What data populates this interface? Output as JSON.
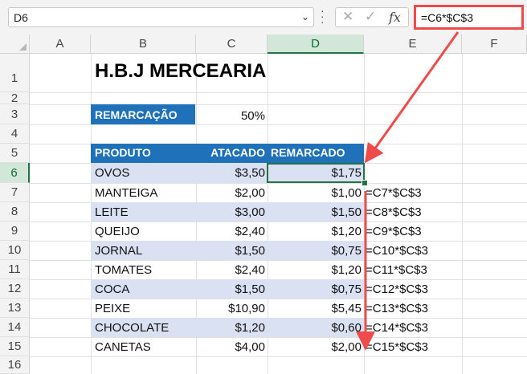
{
  "formula_bar": {
    "name_box": "D6",
    "formula": "=C6*$C$3",
    "cancel_glyph": "✕",
    "enter_glyph": "✓",
    "fx_glyph": "fx"
  },
  "columns": [
    "A",
    "B",
    "C",
    "D",
    "E",
    "F"
  ],
  "rows": [
    "1",
    "2",
    "3",
    "4",
    "5",
    "6",
    "7",
    "8",
    "9",
    "10",
    "11",
    "12",
    "13",
    "14",
    "15",
    "16"
  ],
  "sheet": {
    "title": "H.B.J MERCEARIA",
    "remarcacao_label": "REMARCAÇÃO",
    "remarcacao_value": "50%",
    "headers": {
      "produto": "PRODUTO",
      "atacado": "ATACADO",
      "remarcado": "REMARCADO"
    },
    "items": [
      {
        "produto": "OVOS",
        "atacado": "$3,50",
        "remarcado": "$1,75",
        "formula": ""
      },
      {
        "produto": "MANTEIGA",
        "atacado": "$2,00",
        "remarcado": "$1,00",
        "formula": "=C7*$C$3"
      },
      {
        "produto": "LEITE",
        "atacado": "$3,00",
        "remarcado": "$1,50",
        "formula": "=C8*$C$3"
      },
      {
        "produto": "QUEIJO",
        "atacado": "$2,40",
        "remarcado": "$1,20",
        "formula": "=C9*$C$3"
      },
      {
        "produto": "JORNAL",
        "atacado": "$1,50",
        "remarcado": "$0,75",
        "formula": "=C10*$C$3"
      },
      {
        "produto": "TOMATES",
        "atacado": "$2,40",
        "remarcado": "$1,20",
        "formula": "=C11*$C$3"
      },
      {
        "produto": "COCA",
        "atacado": "$1,50",
        "remarcado": "$0,75",
        "formula": "=C12*$C$3"
      },
      {
        "produto": "PEIXE",
        "atacado": "$10,90",
        "remarcado": "$5,45",
        "formula": "=C13*$C$3"
      },
      {
        "produto": "CHOCOLATE",
        "atacado": "$1,20",
        "remarcado": "$0,60",
        "formula": "=C14*$C$3"
      },
      {
        "produto": "CANETAS",
        "atacado": "$4,00",
        "remarcado": "$2,00",
        "formula": "=C15*$C$3"
      }
    ]
  },
  "colors": {
    "header_blue": "#1f71ba",
    "band": "#d9e1f2",
    "arrow": "#ef4b4b",
    "selection": "#217346"
  },
  "icons": {
    "name_box_dropdown": "chevron-down-icon",
    "more": "kebab-icon",
    "cancel": "cancel-icon",
    "enter": "enter-icon",
    "function": "fx-icon"
  }
}
